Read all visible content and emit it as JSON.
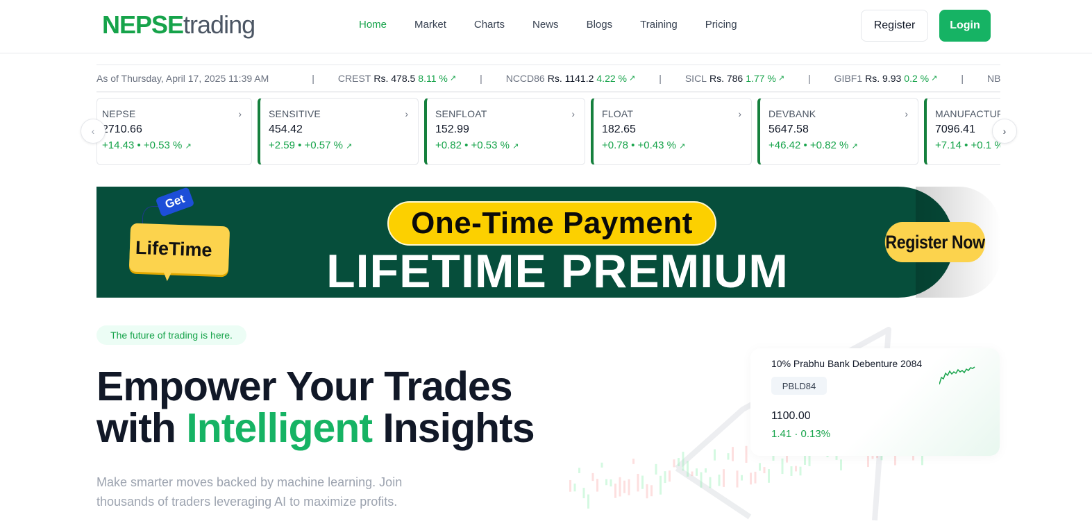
{
  "header": {
    "logo_bold": "NEPSE",
    "logo_light": "trading",
    "nav": [
      "Home",
      "Market",
      "Charts",
      "News",
      "Blogs",
      "Training",
      "Pricing"
    ],
    "active_nav": "Home",
    "register_label": "Register",
    "login_label": "Login"
  },
  "ticker": {
    "date": "As of Thursday, April 17, 2025 11:39 AM",
    "separator": "|",
    "items": [
      {
        "symbol": "CREST",
        "price": "Rs. 478.5",
        "change": "8.11 %"
      },
      {
        "symbol": "NCCD86",
        "price": "Rs. 1141.2",
        "change": "4.22 %"
      },
      {
        "symbol": "SICL",
        "price": "Rs. 786",
        "change": "1.77 %"
      },
      {
        "symbol": "GIBF1",
        "price": "Rs. 9.93",
        "change": "0.2 %"
      },
      {
        "symbol": "NBLD85",
        "price": "Rs",
        "change": ""
      }
    ],
    "trend_icon": "trending-up-icon"
  },
  "indices": [
    {
      "name": "NEPSE",
      "value": "2710.66",
      "change": "+14.43  •  +0.53 %"
    },
    {
      "name": "SENSITIVE",
      "value": "454.42",
      "change": "+2.59  •  +0.57 %"
    },
    {
      "name": "SENFLOAT",
      "value": "152.99",
      "change": "+0.82  •  +0.53 %"
    },
    {
      "name": "FLOAT",
      "value": "182.65",
      "change": "+0.78  •  +0.43 %"
    },
    {
      "name": "DEVBANK",
      "value": "5647.58",
      "change": "+46.42  •  +0.82 %"
    },
    {
      "name": "MANUFACTUR",
      "value": "7096.41",
      "change": "+7.14  •  +0.1 %"
    }
  ],
  "banner": {
    "get": "Get",
    "lifetime": "LifeTime",
    "pill": "One-Time Payment",
    "title": "LIFETIME PREMIUM USER",
    "cta": "Register Now",
    "bg_color": "#064e3b",
    "accent_color": "#fcd000"
  },
  "hero": {
    "tagline": "The future of trading is here.",
    "title_line1": "Empower Your Trades",
    "title_with": "with ",
    "title_green": "Intelligent",
    "title_end": " Insights",
    "subtitle": "Make smarter moves backed by machine learning. Join thousands of traders leveraging AI to maximize profits."
  },
  "stock_card": {
    "name": "10% Prabhu Bank Debenture 2084",
    "symbol": "PBLD84",
    "price": "1100.00",
    "change": "1.41  ·  0.13%"
  },
  "colors": {
    "brand_green": "#16b364",
    "text_dark": "#111827",
    "positive": "#16a34a"
  }
}
